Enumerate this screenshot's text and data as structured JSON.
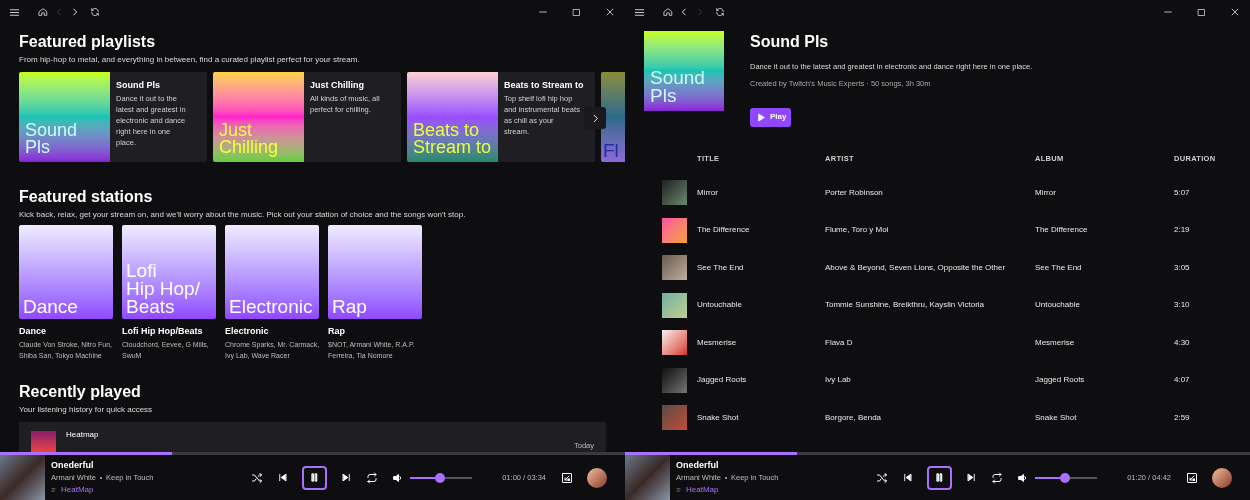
{
  "windows": [
    {
      "kind": "home",
      "nav": {
        "back_disabled": true,
        "forward_disabled": false
      },
      "featured_playlists": {
        "title": "Featured playlists",
        "subtitle": "From hip-hop to metal, and everything in between, find a curated playlist perfect for your stream.",
        "items": [
          {
            "art_text": "Sound Pls",
            "title": "Sound Pls",
            "description": "Dance it out to the latest and greatest in electronic and dance right here in one place."
          },
          {
            "art_text": "Just Chilling",
            "title": "Just Chilling",
            "description": "All kinds of music, all perfect for chilling."
          },
          {
            "art_text": "Beats to Stream to",
            "title": "Beats to Stream to",
            "description": "Top shelf lofi hip hop and instrumental beats as chill as your stream."
          },
          {
            "art_text": "Fl"
          }
        ]
      },
      "featured_stations": {
        "title": "Featured stations",
        "subtitle": "Kick back, relax, get your stream on, and we'll worry about the music. Pick out your station of choice and the songs won't stop.",
        "items": [
          {
            "art_text": "Dance",
            "name": "Dance",
            "artists": "Claude Von Stroke, Nitro Fun, Shiba San, Tokyo Machine"
          },
          {
            "art_text": "Lofi\nHip Hop/\nBeats",
            "name": "Lofi Hip Hop/Beats",
            "artists": "Cloudchord, Eevee, G Mills, SwuM"
          },
          {
            "art_text": "Electronic",
            "name": "Electronic",
            "artists": "Chrome Sparks, Mr. Carmack, Ivy Lab, Wave Racer"
          },
          {
            "art_text": "Rap",
            "name": "Rap",
            "artists": "$NOT, Armani White, R.A.P. Ferreira, Tia Nomore"
          }
        ]
      },
      "recently_played": {
        "title": "Recently played",
        "subtitle": "Your listening history for quick access",
        "items": [
          {
            "title": "Heatmap",
            "time": "Today"
          }
        ]
      },
      "player": {
        "title": "Onederful",
        "artist": "Armani White",
        "album": "Keep in Touch",
        "source": "HeatMap",
        "playing": true,
        "progress": {
          "level": 0.275
        },
        "volume": {
          "level": 0.48
        },
        "time": "01:00 / 03:34"
      }
    },
    {
      "kind": "playlist",
      "nav": {
        "back_disabled": false,
        "forward_disabled": true
      },
      "header": {
        "art_text": "Sound Pls",
        "title": "Sound Pls",
        "description": "Dance it out to the latest and greatest in electronic and dance right here in one place.",
        "meta": "Created by Twitch's Music Experts · 50 songs, 3h 30m",
        "play_label": "Play"
      },
      "table": {
        "columns": [
          "TITLE",
          "ARTIST",
          "ALBUM",
          "DURATION"
        ],
        "rows": [
          {
            "title": "Mirror",
            "artist": "Porter Robinson",
            "album": "Mirror",
            "duration": "5:07"
          },
          {
            "title": "The Difference",
            "artist": "Flume, Toro y Moi",
            "album": "The Difference",
            "duration": "2:19"
          },
          {
            "title": "See The End",
            "artist": "Above & Beyond, Seven Lions, Opposite the Other",
            "album": "See The End",
            "duration": "3:05"
          },
          {
            "title": "Untouchable",
            "artist": "Tommie Sunshine, Breikthru, Kayslin Victoria",
            "album": "Untouchable",
            "duration": "3:10"
          },
          {
            "title": "Mesmerise",
            "artist": "Flava D",
            "album": "Mesmerise",
            "duration": "4:30"
          },
          {
            "title": "Jagged Roots",
            "artist": "Ivy Lab",
            "album": "Jagged Roots",
            "duration": "4:07"
          },
          {
            "title": "Snake Shot",
            "artist": "Borgore, Benda",
            "album": "Snake Shot",
            "duration": "2:59"
          }
        ]
      },
      "player": {
        "title": "Onederful",
        "artist": "Armani White",
        "album": "Keep in Touch",
        "source": "HeatMap",
        "playing": true,
        "progress": {
          "level": 0.275
        },
        "volume": {
          "level": 0.48
        },
        "time": "01:20 / 04:42"
      }
    }
  ]
}
